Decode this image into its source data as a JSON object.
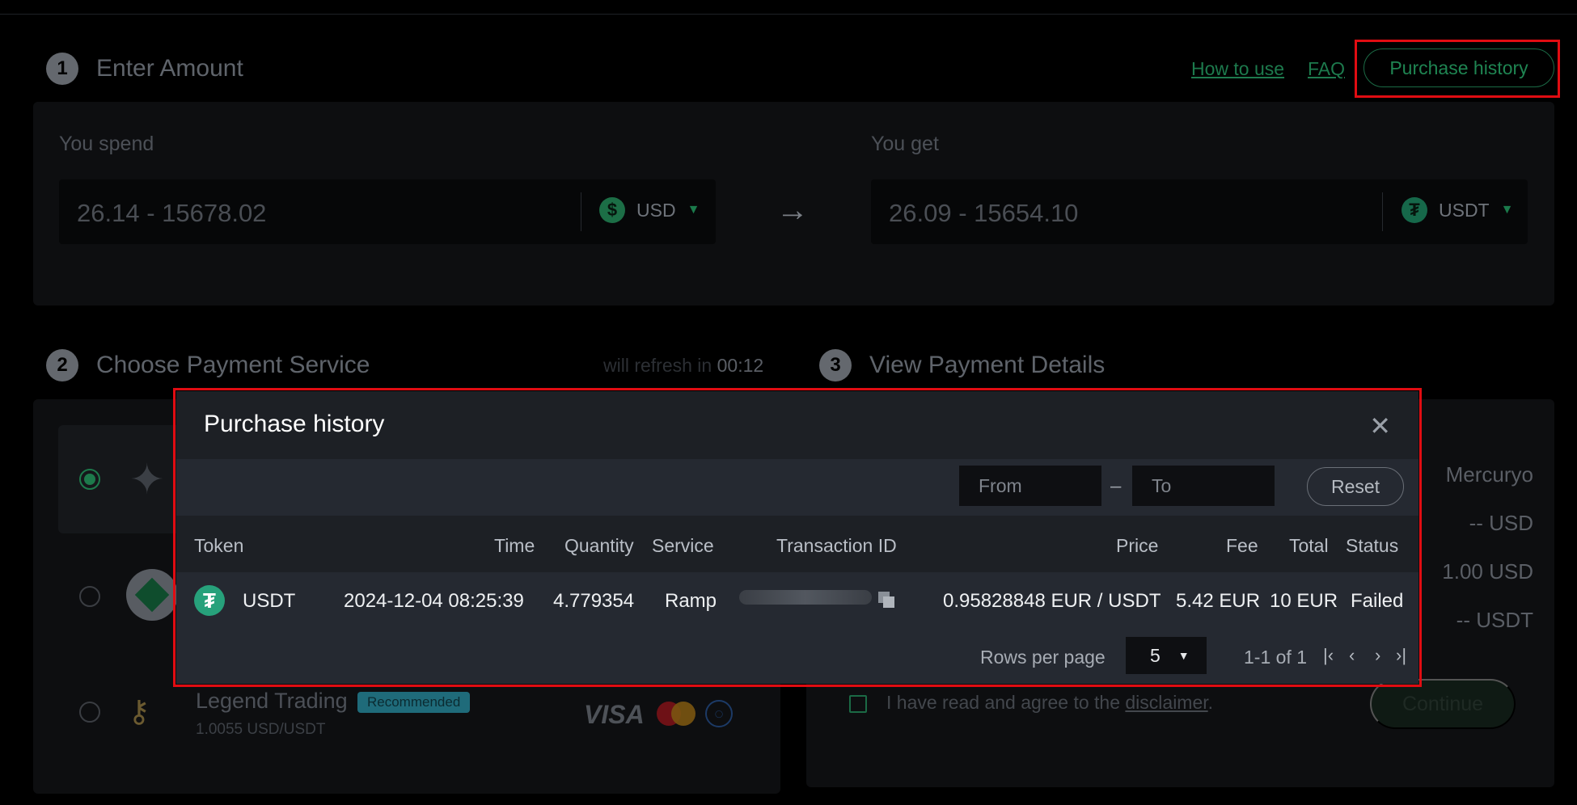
{
  "steps": {
    "one": {
      "num": "1",
      "title": "Enter Amount"
    },
    "two": {
      "num": "2",
      "title": "Choose Payment Service"
    },
    "three": {
      "num": "3",
      "title": "View Payment Details"
    }
  },
  "links": {
    "how_to_use": "How to use",
    "faq": "FAQ",
    "purchase_history": "Purchase history"
  },
  "spend": {
    "label": "You spend",
    "placeholder": "26.14 - 15678.02",
    "currency": "USD",
    "icon": "dollar-icon"
  },
  "get": {
    "label": "You get",
    "placeholder": "26.09 - 15654.10",
    "currency": "USDT",
    "icon": "tether-icon"
  },
  "refresh": {
    "prefix": "will refresh in",
    "time": "00:12"
  },
  "services": {
    "legend": {
      "name": "Legend Trading",
      "badge": "Recommended",
      "rate": "1.0055 USD/USDT"
    },
    "visa": "VISA"
  },
  "details": {
    "provider": "Mercuryo",
    "line1": "-- USD",
    "line2": "1.00 USD",
    "line3": "-- USDT"
  },
  "agree": {
    "text": "I have read and agree to the",
    "link": "disclaimer",
    "end": ".",
    "continue": "Continue"
  },
  "modal": {
    "title": "Purchase history",
    "from_placeholder": "From",
    "to_placeholder": "To",
    "dash": "–",
    "reset": "Reset",
    "columns": {
      "token": "Token",
      "time": "Time",
      "quantity": "Quantity",
      "service": "Service",
      "txid": "Transaction ID",
      "price": "Price",
      "fee": "Fee",
      "total": "Total",
      "status": "Status"
    },
    "rows": [
      {
        "token": "USDT",
        "time": "2024-12-04 08:25:39",
        "quantity": "4.779354",
        "service": "Ramp",
        "price": "0.95828848 EUR / USDT",
        "fee": "5.42 EUR",
        "total": "10 EUR",
        "status": "Failed"
      }
    ],
    "footer": {
      "rows_per_page": "Rows per page",
      "rows_value": "5",
      "range": "1-1 of 1"
    }
  },
  "colors": {
    "accent": "#1f8552",
    "highlight": "#e00c12",
    "tether": "#27a17b"
  }
}
